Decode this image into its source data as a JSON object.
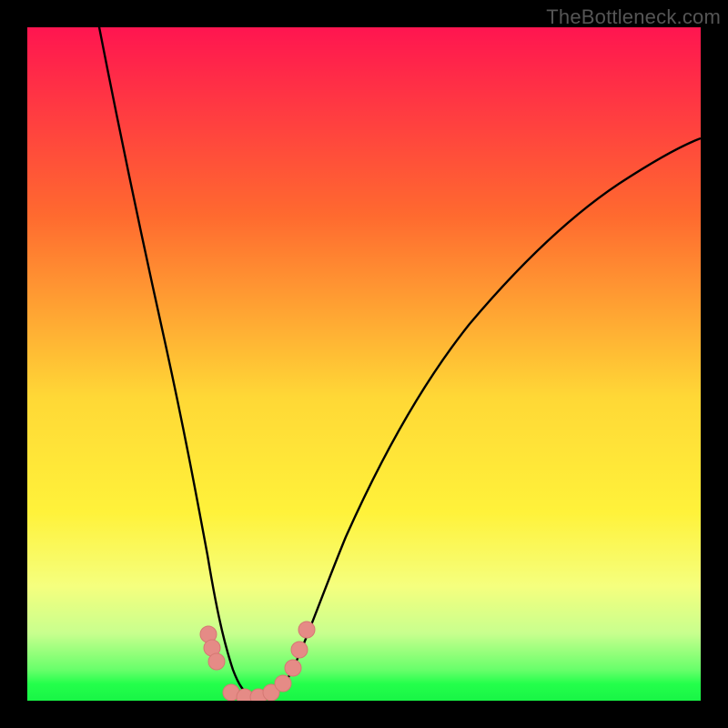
{
  "watermark": "TheBottleneck.com",
  "colors": {
    "frame": "#000000",
    "curve": "#000000",
    "marker_fill": "#e58b86",
    "marker_stroke": "#d47672",
    "green_band": "#24ff4b",
    "pale_green": "#b6ff8c",
    "pale_yellow": "#f5ff7e",
    "yellow": "#ffe63a",
    "orange": "#ff9b2f",
    "red_top": "#ff1550"
  },
  "chart_data": {
    "type": "line",
    "x": [
      0.0,
      0.05,
      0.1,
      0.15,
      0.2,
      0.22,
      0.25,
      0.27,
      0.3,
      0.33,
      0.36,
      0.4,
      0.45,
      0.5,
      0.55,
      0.6,
      0.65,
      0.7,
      0.75,
      0.8,
      0.85,
      0.9,
      0.95,
      1.0
    ],
    "values": [
      1.3,
      1.0,
      0.78,
      0.58,
      0.4,
      0.3,
      0.18,
      0.1,
      0.02,
      0.0,
      0.01,
      0.06,
      0.15,
      0.24,
      0.33,
      0.41,
      0.49,
      0.56,
      0.62,
      0.67,
      0.72,
      0.76,
      0.79,
      0.81
    ],
    "title": "",
    "xlabel": "",
    "ylabel": "",
    "xlim": [
      0,
      1
    ],
    "ylim": [
      0,
      1
    ],
    "series": [
      {
        "name": "bottleneck-curve",
        "x": [
          0.0,
          0.05,
          0.1,
          0.15,
          0.2,
          0.22,
          0.25,
          0.27,
          0.3,
          0.33,
          0.36,
          0.4,
          0.45,
          0.5,
          0.55,
          0.6,
          0.65,
          0.7,
          0.75,
          0.8,
          0.85,
          0.9,
          0.95,
          1.0
        ],
        "y": [
          1.3,
          1.0,
          0.78,
          0.58,
          0.4,
          0.3,
          0.18,
          0.1,
          0.02,
          0.0,
          0.01,
          0.06,
          0.15,
          0.24,
          0.33,
          0.41,
          0.49,
          0.56,
          0.62,
          0.67,
          0.72,
          0.76,
          0.79,
          0.81
        ]
      }
    ],
    "markers": [
      {
        "x": 0.266,
        "y": 0.095
      },
      {
        "x": 0.272,
        "y": 0.075
      },
      {
        "x": 0.278,
        "y": 0.055
      },
      {
        "x": 0.3,
        "y": 0.008
      },
      {
        "x": 0.32,
        "y": 0.002
      },
      {
        "x": 0.34,
        "y": 0.002
      },
      {
        "x": 0.36,
        "y": 0.008
      },
      {
        "x": 0.378,
        "y": 0.022
      },
      {
        "x": 0.392,
        "y": 0.045
      },
      {
        "x": 0.402,
        "y": 0.072
      },
      {
        "x": 0.412,
        "y": 0.102
      }
    ],
    "gradient_stops": [
      {
        "offset": 0.0,
        "color": "#ff1550"
      },
      {
        "offset": 0.28,
        "color": "#ff6a2f"
      },
      {
        "offset": 0.55,
        "color": "#ffd836"
      },
      {
        "offset": 0.72,
        "color": "#fff23a"
      },
      {
        "offset": 0.83,
        "color": "#f5ff7e"
      },
      {
        "offset": 0.9,
        "color": "#c8ff8e"
      },
      {
        "offset": 0.955,
        "color": "#66ff6a"
      },
      {
        "offset": 0.975,
        "color": "#24ff4b"
      },
      {
        "offset": 1.0,
        "color": "#18f546"
      }
    ]
  }
}
